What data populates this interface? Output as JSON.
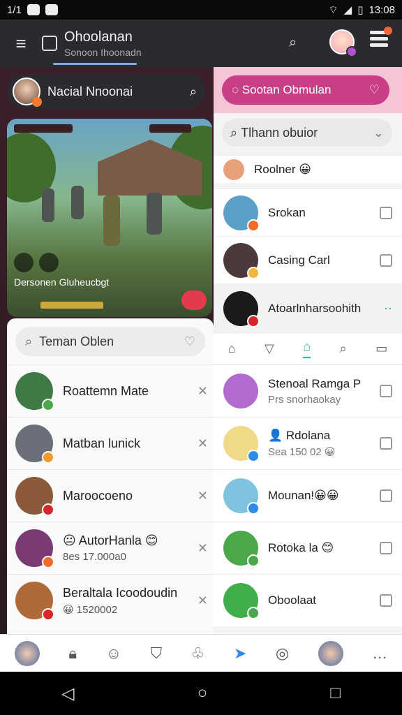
{
  "status_bar": {
    "time_left": "1/1",
    "time_right": "13:08"
  },
  "appbar": {
    "title": "Ohoolanan",
    "subtitle": "Sonoon Ihoonadn"
  },
  "left": {
    "profile_name": "Nacial Nnoonai",
    "game_caption": "Dersonen Gluheucbgt",
    "friends_search": "Teman Oblen",
    "friends": [
      {
        "name": "Roattemn Mate",
        "sub": "",
        "badge": "#4aa84a",
        "bg": "#3d7a45"
      },
      {
        "name": "Matban lunick",
        "sub": "",
        "badge": "#f39a2a",
        "bg": "#6b6f7a"
      },
      {
        "name": "Maroocoeno",
        "sub": "",
        "badge": "#d9252a",
        "bg": "#8a5a3a"
      },
      {
        "name": "😐 AutorHanla 😊",
        "sub": "8es 17.000а0",
        "badge": "#f06a2a",
        "bg": "#7a3a74"
      },
      {
        "name": "Beraltala Icoodoudin",
        "sub": "😀 1520002",
        "badge": "#d9252a",
        "bg": "#b06a3a"
      }
    ]
  },
  "right": {
    "header": "Sootan Obmulan",
    "search": "Tlhann obuior",
    "top_list": [
      {
        "name": "Roolner 😀",
        "sub": "",
        "badge": "",
        "bg": "#e7a07a"
      },
      {
        "name": "Srokan",
        "sub": "",
        "badge": "#f06a2a",
        "bg": "#5aa0c8"
      },
      {
        "name": "Casing Carl",
        "sub": "",
        "badge": "#f2b63a",
        "bg": "#4a3a3a"
      },
      {
        "name": "Atoarlnharsoohith",
        "sub": "",
        "badge": "#d9252a",
        "bg": "#1a1a1a"
      }
    ],
    "tabs": [
      "home",
      "filter",
      "bag",
      "search",
      "card"
    ],
    "bottom_list": [
      {
        "name": "Stenoal Ramga P",
        "sub": "Prs snorhaokay",
        "badge": "",
        "bg": "#b06ad0"
      },
      {
        "name": "👤 Rdolana",
        "sub": "Sea 150 02 😀",
        "badge": "#2d8ce8",
        "bg": "#f1d98a"
      },
      {
        "name": "Mounan!😀😀",
        "sub": "",
        "badge": "#2d8ce8",
        "bg": "#7fc3e0"
      },
      {
        "name": "Rotoka la 😊",
        "sub": "",
        "badge": "#4aa84a",
        "bg": "#4aa84a"
      },
      {
        "name": "Oboolaat",
        "sub": "",
        "badge": "#4aa84a",
        "bg": "#3fae4a"
      }
    ]
  },
  "bottom_nav": [
    "home-icon",
    "lock-icon",
    "face-icon",
    "badge-icon",
    "leaf-icon",
    "send-icon",
    "steering-icon",
    "avatar",
    "more-icon"
  ],
  "android_nav": [
    "back",
    "home",
    "recent"
  ]
}
